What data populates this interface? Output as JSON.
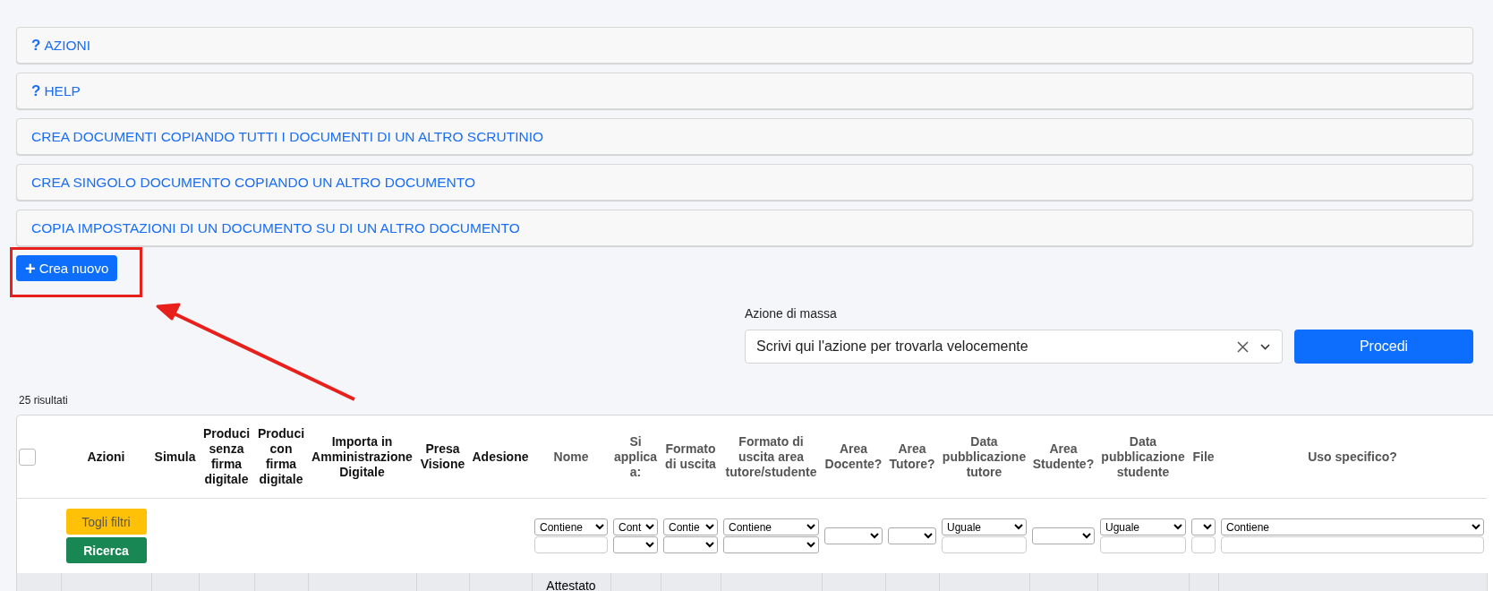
{
  "accordions": [
    {
      "icon": "?",
      "label": "AZIONI"
    },
    {
      "icon": "?",
      "label": "HELP"
    },
    {
      "label": "CREA DOCUMENTI COPIANDO TUTTI I DOCUMENTI DI UN ALTRO SCRUTINIO"
    },
    {
      "label": "CREA SINGOLO DOCUMENTO COPIANDO UN ALTRO DOCUMENTO"
    },
    {
      "label": "COPIA IMPOSTAZIONI DI UN DOCUMENTO SU DI UN ALTRO DOCUMENTO"
    }
  ],
  "create_button": {
    "icon": "+",
    "label": "Crea nuovo"
  },
  "mass_action": {
    "label": "Azione di massa",
    "placeholder": "Scrivi qui l'azione per trovarla velocemente",
    "button": "Procedi"
  },
  "results_count": "25 risultati",
  "table": {
    "select_all": {
      "checked": false
    },
    "columns": [
      {
        "kind": "action",
        "label": "Azioni",
        "filter": {
          "kind": "buttons",
          "buttons": [
            {
              "kind": "warning",
              "label": "Togli filtri"
            },
            {
              "kind": "success",
              "label": "Ricerca"
            }
          ]
        }
      },
      {
        "kind": "action",
        "label": "Simula"
      },
      {
        "kind": "action",
        "label": "Produci senza firma digitale"
      },
      {
        "kind": "action",
        "label": "Produci con firma digitale"
      },
      {
        "kind": "action",
        "label": "Importa in Amministrazione Digitale"
      },
      {
        "kind": "action",
        "label": "Presa Visione"
      },
      {
        "kind": "action",
        "label": "Adesione"
      },
      {
        "kind": "field",
        "label": "Nome",
        "filter": {
          "kind": "select_text",
          "value": "Contiene"
        },
        "cells": [
          "Attestato"
        ]
      },
      {
        "kind": "field",
        "label": "Si applica a:",
        "filter": {
          "kind": "select_select",
          "value": "Cont"
        }
      },
      {
        "kind": "field",
        "label": "Formato di uscita",
        "filter": {
          "kind": "select_select",
          "value": "Contie"
        }
      },
      {
        "kind": "field",
        "label": "Formato di uscita area tutore/studente",
        "filter": {
          "kind": "select_select",
          "value": "Contiene"
        }
      },
      {
        "kind": "field",
        "label": "Area Docente?",
        "filter": {
          "kind": "select"
        }
      },
      {
        "kind": "field",
        "label": "Area Tutore?",
        "filter": {
          "kind": "select"
        }
      },
      {
        "kind": "field",
        "label": "Data pubblicazione tutore",
        "filter": {
          "kind": "select_text",
          "value": "Uguale"
        }
      },
      {
        "kind": "field",
        "label": "Area Studente?",
        "filter": {
          "kind": "select"
        }
      },
      {
        "kind": "field",
        "label": "Data pubblicazione studente",
        "filter": {
          "kind": "select_text",
          "value": "Uguale"
        }
      },
      {
        "kind": "field",
        "label": "File",
        "filter": {
          "kind": "select_text"
        }
      },
      {
        "kind": "field",
        "label": "Uso specifico?",
        "filter": {
          "kind": "select_text",
          "value": "Contiene"
        }
      }
    ]
  }
}
